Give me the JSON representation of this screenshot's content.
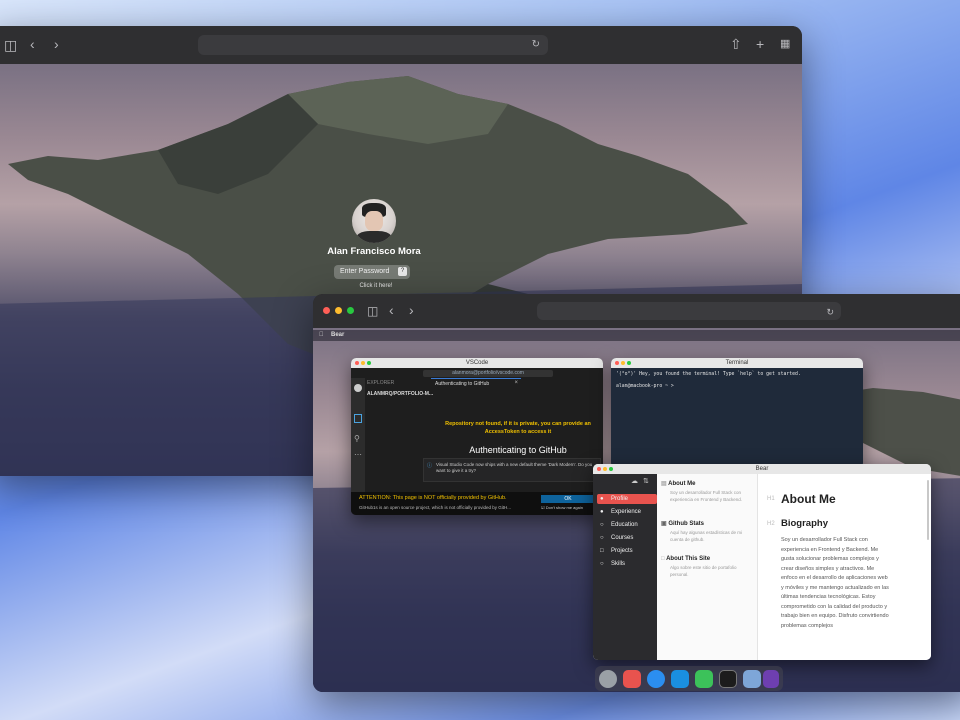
{
  "back_browser": {
    "login": {
      "user_name": "Alan Francisco Mora",
      "password_placeholder": "Enter Password",
      "hint": "Click it here!"
    }
  },
  "front_browser": {
    "menubar_app": "Bear",
    "vscode": {
      "title": "VSCode",
      "url": "alanmora@portfolio/vscode.com",
      "explorer_label": "EXPLORER",
      "folder_label": "ALANMRQ/PORTFOLIO-M...",
      "tab_label": "Authenticating to GitHub",
      "error_text": "Repository not found, if it is private, you can provide an AccessToken to access it",
      "heading": "Authenticating to GitHub",
      "theme_notice": "Visual Studio Code now ships with a new default theme 'Dark Modern'. Do you want to give it a try?",
      "attention_title": "ATTENTION: This page is NOT officially provided by GitHub.",
      "attention_body": "GitHub1s is an open source project, which is not officially provided by GitH...",
      "ok_label": "OK",
      "dont_show_label": "Don't show me again"
    },
    "terminal": {
      "title": "Terminal",
      "welcome": "'(°o°)' Hey, you found the terminal! Type `help` to get started.",
      "prompt": "alan@macbook-pro ~ >"
    },
    "bear": {
      "title": "Bear",
      "sidebar": [
        "Profile",
        "Experience",
        "Education",
        "Courses",
        "Projects",
        "Skills"
      ],
      "notes": [
        {
          "title": "About Me",
          "snippet": "Soy un desarrollador Full Stack con experiencia en Frontend y Backend."
        },
        {
          "title": "Github Stats",
          "snippet": "Aquí hay algunas estadísticas de mi cuenta de github."
        },
        {
          "title": "About This Site",
          "snippet": "Algo sobre este sitio de portafolio personal."
        }
      ],
      "content": {
        "h1": "About Me",
        "h2": "Biography",
        "body": "Soy un desarrollador Full Stack con experiencia en Frontend y Backend. Me gusta solucionar problemas complejos y crear diseños simples y atractivos. Me enfoco en el desarrollo de aplicaciones web y móviles y me mantengo actualizado en las últimas tendencias tecnológicas. Estoy comprometido con la calidad del producto y trabajo bien en equipo. Disfruto convirtiendo problemas complejos"
      }
    }
  },
  "colors": {
    "accent_red": "#e8534e",
    "vscode_bg": "#1e1e1e",
    "terminal_bg": "#1f2a3a",
    "bear_sidebar": "#2b2b2e"
  }
}
